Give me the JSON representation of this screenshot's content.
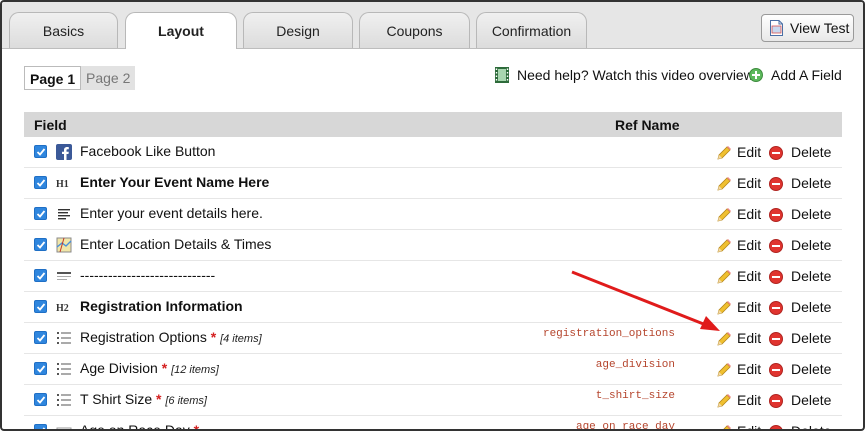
{
  "tabs": [
    {
      "label": "Basics",
      "active": false
    },
    {
      "label": "Layout",
      "active": true
    },
    {
      "label": "Design",
      "active": false
    },
    {
      "label": "Coupons",
      "active": false
    },
    {
      "label": "Confirmation",
      "active": false
    }
  ],
  "view_test_label": "View Test",
  "pages": {
    "page1": "Page 1",
    "page2": "Page 2"
  },
  "help_text": "Need help? Watch this video overview",
  "add_field_label": "Add A Field",
  "table": {
    "header_field": "Field",
    "header_ref": "Ref Name",
    "edit_label": "Edit",
    "delete_label": "Delete",
    "rows": [
      {
        "icon": "facebook-icon",
        "label": "Facebook Like Button",
        "bold": false,
        "required": false,
        "items": "",
        "ref": ""
      },
      {
        "icon": "heading1-icon",
        "label": "Enter Your Event Name Here",
        "bold": true,
        "required": false,
        "items": "",
        "ref": ""
      },
      {
        "icon": "text-lines-icon",
        "label": "Enter your event details here.",
        "bold": false,
        "required": false,
        "items": "",
        "ref": ""
      },
      {
        "icon": "map-icon",
        "label": "Enter Location Details & Times",
        "bold": false,
        "required": false,
        "items": "",
        "ref": ""
      },
      {
        "icon": "divider-icon",
        "label": "-----------------------------",
        "bold": false,
        "required": false,
        "items": "",
        "ref": ""
      },
      {
        "icon": "heading2-icon",
        "label": "Registration Information",
        "bold": true,
        "required": false,
        "items": "",
        "ref": ""
      },
      {
        "icon": "list-icon",
        "label": "Registration Options",
        "bold": false,
        "required": true,
        "items": "[4 items]",
        "ref": "registration_options"
      },
      {
        "icon": "list-icon",
        "label": "Age Division",
        "bold": false,
        "required": true,
        "items": "[12 items]",
        "ref": "age_division"
      },
      {
        "icon": "list-icon",
        "label": "T Shirt Size",
        "bold": false,
        "required": true,
        "items": "[6 items]",
        "ref": "t_shirt_size"
      },
      {
        "icon": "textbox-icon",
        "label": "Age on Race Day",
        "bold": false,
        "required": true,
        "items": "",
        "ref": "age_on_race_day"
      }
    ]
  },
  "required_marker": "*",
  "colors": {
    "checkbox": "#2f86de",
    "ref_text": "#b5452d",
    "arrow": "#e01b1b",
    "delete": "#e0342f"
  }
}
